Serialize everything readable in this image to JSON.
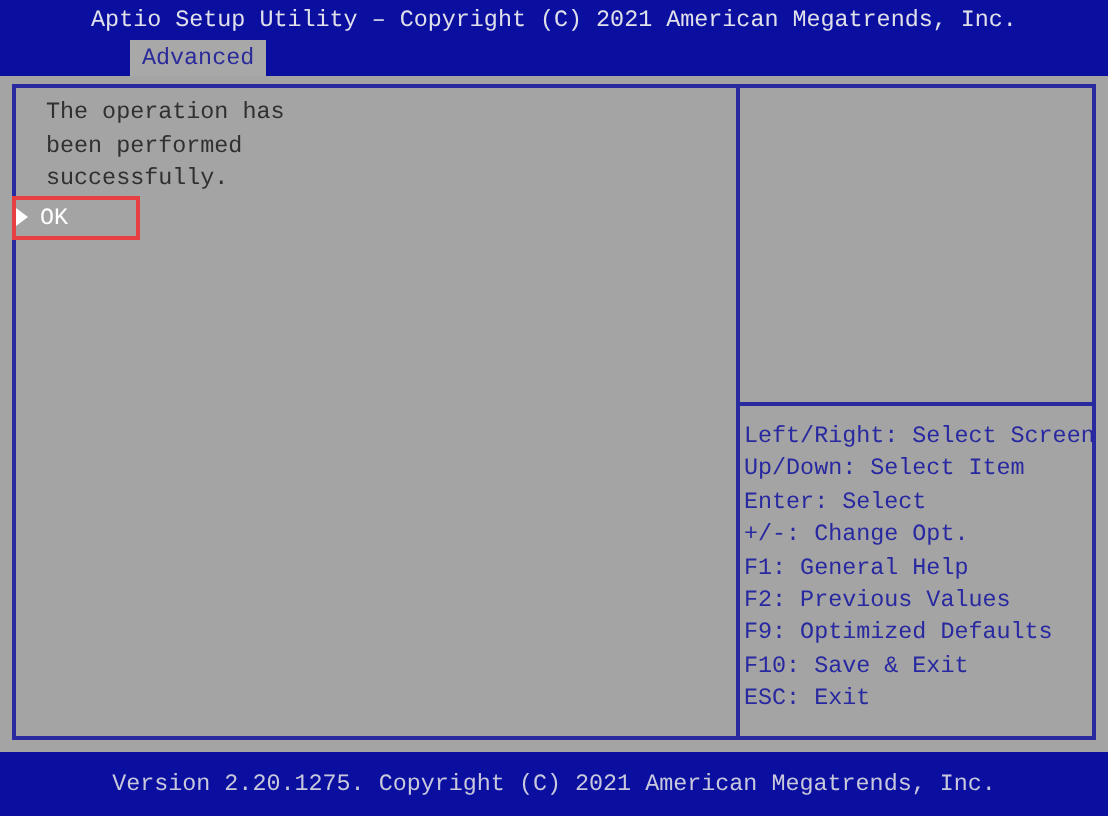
{
  "header": {
    "title": "Aptio Setup Utility – Copyright (C) 2021 American Megatrends, Inc.",
    "tabs": [
      {
        "label": "Advanced",
        "selected": true
      }
    ]
  },
  "main": {
    "message": [
      "The operation has",
      "been performed",
      "successfully."
    ],
    "items": [
      {
        "label": "OK",
        "selected": true,
        "annotated": true
      }
    ]
  },
  "help": {
    "keys": [
      "Left/Right: Select Screen",
      "Up/Down: Select Item",
      "Enter: Select",
      "+/-: Change Opt.",
      "F1: General Help",
      "F2: Previous Values",
      "F9: Optimized Defaults",
      "F10: Save & Exit",
      "ESC: Exit"
    ]
  },
  "footer": {
    "text": "Version 2.20.1275. Copyright (C) 2021 American Megatrends, Inc."
  }
}
